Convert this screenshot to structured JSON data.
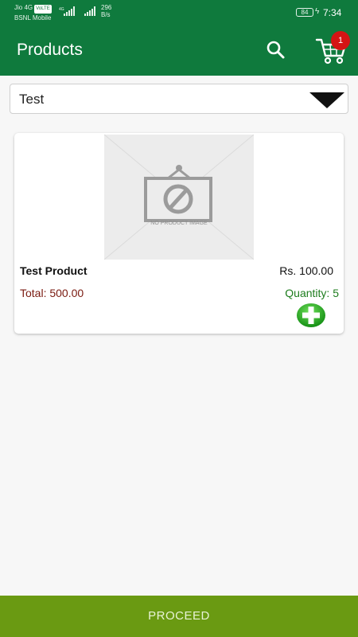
{
  "status_bar": {
    "carrier_1": "Jio 4G",
    "carrier_1_badge": "VoLTE",
    "carrier_2": "BSNL Mobile",
    "net_type": "4G",
    "net_speed_value": "296",
    "net_speed_unit": "B/s",
    "battery": "84",
    "time": "7:34",
    "icons": [
      "signal-icon",
      "signal-icon",
      "battery-icon",
      "charging-icon"
    ]
  },
  "app_bar": {
    "title": "Products",
    "search_icon": "search-icon",
    "cart_icon": "cart-icon",
    "cart_count": "1",
    "badge_color": "#d41414",
    "background": "#0f7a3d"
  },
  "category_select": {
    "value": "Test",
    "icon": "chevron-down-icon"
  },
  "products": [
    {
      "image_placeholder": "NO PRODUCT IMAGE",
      "name": "Test Product",
      "price": "Rs. 100.00",
      "total": "Total: 500.00",
      "quantity": "Quantity: 5",
      "add_icon": "add-icon"
    }
  ],
  "footer": {
    "proceed_label": "PROCEED",
    "background": "#6a9a12"
  }
}
